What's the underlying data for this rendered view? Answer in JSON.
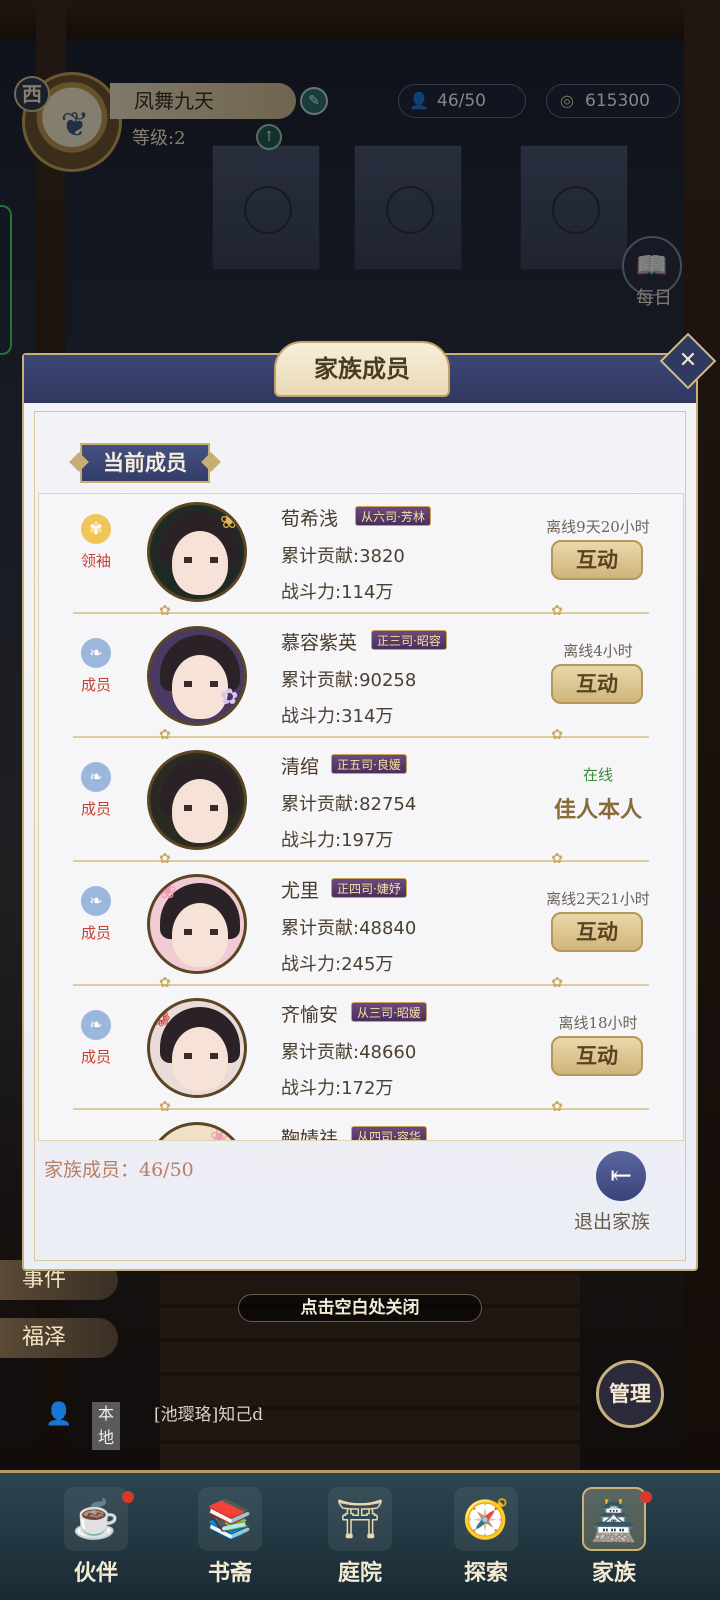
{
  "hud": {
    "server_badge": "西",
    "player_name": "凤舞九天",
    "level_text": "等级:2",
    "members_count": "46/50",
    "coins": "615300",
    "daily_label": "每日"
  },
  "modal": {
    "title": "家族成员",
    "section_tab": "当前成员",
    "members": [
      {
        "role": "领袖",
        "name": "荀希浅",
        "rank": "从六司·芳林",
        "contribution": "累计贡献:3820",
        "power": "战斗力:114万",
        "status": "离线9天20小时",
        "action": "互动"
      },
      {
        "role": "成员",
        "name": "慕容紫英",
        "rank": "正三司·昭容",
        "contribution": "累计贡献:90258",
        "power": "战斗力:314万",
        "status": "离线4小时",
        "action": "互动"
      },
      {
        "role": "成员",
        "name": "清绾",
        "rank": "正五司·良媛",
        "contribution": "累计贡献:82754",
        "power": "战斗力:197万",
        "status": "在线",
        "action": "佳人本人"
      },
      {
        "role": "成员",
        "name": "尤里",
        "rank": "正四司·婕妤",
        "contribution": "累计贡献:48840",
        "power": "战斗力:245万",
        "status": "离线2天21小时",
        "action": "互动"
      },
      {
        "role": "成员",
        "name": "齐愉安",
        "rank": "从三司·昭媛",
        "contribution": "累计贡献:48660",
        "power": "战斗力:172万",
        "status": "离线18小时",
        "action": "互动"
      },
      {
        "name": "鞠婧祎",
        "rank": "从四司·容华"
      }
    ],
    "members_count_label": "家族成员：46/50",
    "exit_label": "退出家族"
  },
  "overlay": {
    "close_hint": "点击空白处关闭",
    "side_event": "事件",
    "side_blessing": "福泽",
    "manage": "管理"
  },
  "chat": {
    "channel": "本地",
    "message": "[池璎珞]知己d"
  },
  "nav": {
    "items": [
      {
        "label": "伙伴",
        "icon": "teapot-icon"
      },
      {
        "label": "书斋",
        "icon": "book-icon"
      },
      {
        "label": "庭院",
        "icon": "pavilion-icon"
      },
      {
        "label": "探索",
        "icon": "explore-icon"
      },
      {
        "label": "家族",
        "icon": "clan-icon"
      }
    ]
  }
}
